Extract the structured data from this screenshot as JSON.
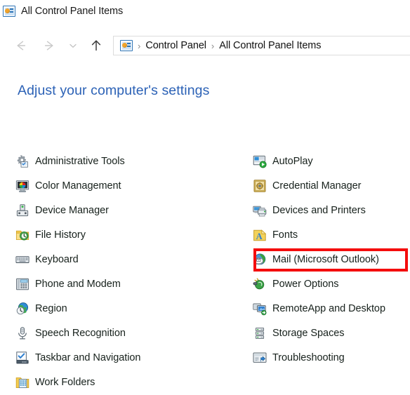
{
  "window": {
    "title": "All Control Panel Items",
    "icon": "control-panel-icon"
  },
  "navigation": {
    "back": "back-arrow-icon",
    "forward": "forward-arrow-icon",
    "history": "recent-locations-chevron-icon",
    "up": "up-arrow-icon",
    "breadcrumb": {
      "icon": "control-panel-icon",
      "separator": "›",
      "items": [
        "Control Panel",
        "All Control Panel Items"
      ]
    }
  },
  "heading": "Adjust your computer's settings",
  "items": {
    "left_column": [
      {
        "label": "Administrative Tools",
        "icon": "administrative-tools-icon"
      },
      {
        "label": "Color Management",
        "icon": "color-management-icon"
      },
      {
        "label": "Device Manager",
        "icon": "device-manager-icon"
      },
      {
        "label": "File History",
        "icon": "file-history-icon"
      },
      {
        "label": "Keyboard",
        "icon": "keyboard-icon"
      },
      {
        "label": "Phone and Modem",
        "icon": "phone-and-modem-icon"
      },
      {
        "label": "Region",
        "icon": "region-icon"
      },
      {
        "label": "Speech Recognition",
        "icon": "speech-recognition-icon"
      },
      {
        "label": "Taskbar and Navigation",
        "icon": "taskbar-and-navigation-icon"
      },
      {
        "label": "Work Folders",
        "icon": "work-folders-icon"
      }
    ],
    "right_column": [
      {
        "label": "AutoPlay",
        "icon": "autoplay-icon"
      },
      {
        "label": "Credential Manager",
        "icon": "credential-manager-icon"
      },
      {
        "label": "Devices and Printers",
        "icon": "devices-and-printers-icon"
      },
      {
        "label": "Fonts",
        "icon": "fonts-icon"
      },
      {
        "label": "Mail (Microsoft Outlook)",
        "icon": "mail-icon",
        "highlighted": true
      },
      {
        "label": "Power Options",
        "icon": "power-options-icon"
      },
      {
        "label": "RemoteApp and Desktop",
        "icon": "remoteapp-and-desktop-icon"
      },
      {
        "label": "Storage Spaces",
        "icon": "storage-spaces-icon"
      },
      {
        "label": "Troubleshooting",
        "icon": "troubleshooting-icon"
      }
    ]
  },
  "annotation": {
    "target": "Mail (Microsoft Outlook)",
    "color": "#f40d0d"
  },
  "colors": {
    "heading": "#2c62b6",
    "item_label": "#17211c",
    "title": "#1a1a1a",
    "highlight": "#f40d0d",
    "background": "#ffffff"
  }
}
